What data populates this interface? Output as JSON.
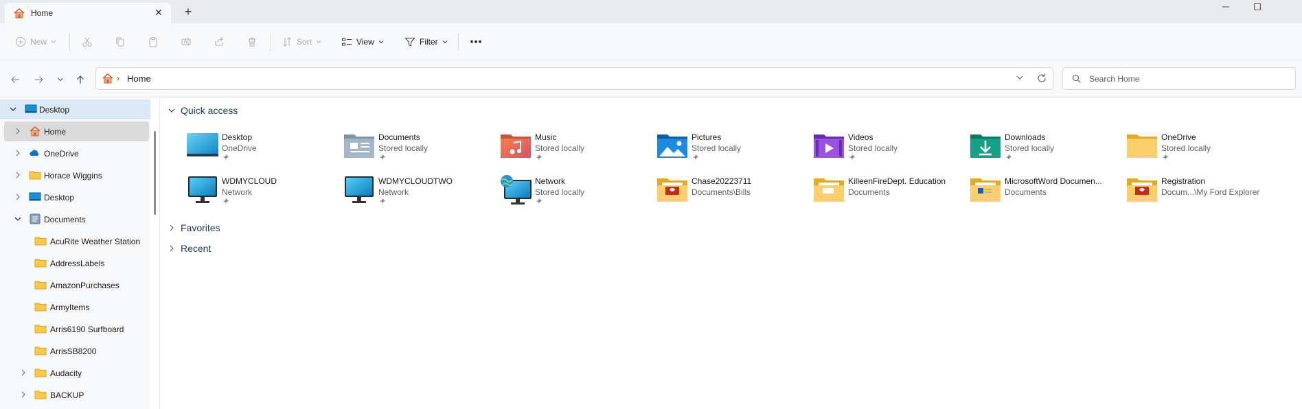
{
  "tab": {
    "title": "Home",
    "close_glyph": "✕",
    "new_glyph": "+"
  },
  "window": {
    "minimize": "—",
    "maximize": "☐"
  },
  "commands": {
    "new": "New",
    "sort": "Sort",
    "view": "View",
    "filter": "Filter",
    "more": "⋯"
  },
  "address": {
    "path": "Home",
    "separator": "›"
  },
  "search": {
    "placeholder": "Search Home"
  },
  "sidebar": {
    "items": [
      {
        "label": "Desktop"
      },
      {
        "label": "Home"
      },
      {
        "label": "OneDrive"
      },
      {
        "label": "Horace Wiggins"
      },
      {
        "label": "Desktop"
      },
      {
        "label": "Documents"
      },
      {
        "label": "AcuRite Weather Station"
      },
      {
        "label": "AddressLabels"
      },
      {
        "label": "AmazonPurchases"
      },
      {
        "label": "ArmyItems"
      },
      {
        "label": "Arris6190 Surfboard"
      },
      {
        "label": "ArrisSB8200"
      },
      {
        "label": "Audacity"
      },
      {
        "label": "BACKUP"
      }
    ]
  },
  "main": {
    "sections": {
      "quick_access": "Quick access",
      "favorites": "Favorites",
      "recent": "Recent"
    },
    "quick_access": [
      {
        "name": "Desktop",
        "sub": "OneDrive",
        "icon": "desktop-icon"
      },
      {
        "name": "Documents",
        "sub": "Stored locally",
        "icon": "documents-icon"
      },
      {
        "name": "Music",
        "sub": "Stored locally",
        "icon": "music-icon"
      },
      {
        "name": "Pictures",
        "sub": "Stored locally",
        "icon": "pictures-icon"
      },
      {
        "name": "Videos",
        "sub": "Stored locally",
        "icon": "videos-icon"
      },
      {
        "name": "Downloads",
        "sub": "Stored locally",
        "icon": "downloads-icon"
      },
      {
        "name": "OneDrive",
        "sub": "Stored locally",
        "icon": "folder-icon"
      },
      {
        "name": "WDMYCLOUD",
        "sub": "Network",
        "icon": "monitor-icon"
      },
      {
        "name": "WDMYCLOUDTWO",
        "sub": "Network",
        "icon": "monitor-icon"
      },
      {
        "name": "Network",
        "sub": "Stored locally",
        "icon": "network-icon"
      },
      {
        "name": "Chase20223711",
        "sub": "Documents\\Bills",
        "icon": "pdf-folder-icon"
      },
      {
        "name": "KilleenFireDept. Education",
        "sub": "Documents",
        "icon": "folder-icon"
      },
      {
        "name": "MicrosoftWord Documen...",
        "sub": "Documents",
        "icon": "word-folder-icon"
      },
      {
        "name": "Registration",
        "sub": "Docum...\\My Ford Explorer",
        "icon": "pdf-folder-icon"
      }
    ]
  },
  "colors": {
    "accent": "#0067c0",
    "folder": "#f8c94a",
    "sidebar_bg": "#f7f8fa"
  }
}
